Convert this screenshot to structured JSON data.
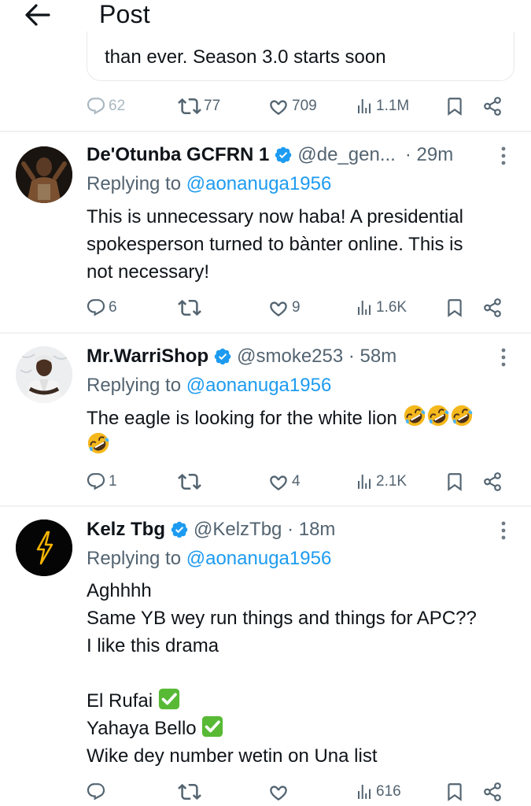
{
  "header": {
    "title": "Post"
  },
  "quote": {
    "text": "than ever. Season 3.0 starts soon"
  },
  "main_actions": {
    "replies": "62",
    "reposts": "77",
    "likes": "709",
    "views": "1.1M"
  },
  "colors": {
    "accent": "#1d9bf0",
    "secondary_text": "#536471",
    "verified": "#1d9bf0"
  },
  "replies": [
    {
      "name": "De'Otunba GCFRN 1",
      "handle": "@de_gen...",
      "time": "· 29m",
      "replying_prefix": "Replying to",
      "replying_to": "@aonanuga1956",
      "lines": [
        "This is unnecessary now haba! A presidential",
        "spokesperson turned to bànter online. This is",
        "not necessary!"
      ],
      "counts": {
        "replies": "6",
        "reposts": "",
        "likes": "9",
        "views": "1.6K"
      }
    },
    {
      "name": "Mr.WarriShop",
      "handle": "@smoke253 · 58m",
      "time": "",
      "replying_prefix": "Replying to",
      "replying_to": "@aonanuga1956",
      "lines": [
        "The eagle is looking for the white lion"
      ],
      "emoji": "rolling-on-floor-laughing",
      "counts": {
        "replies": "1",
        "reposts": "",
        "likes": "4",
        "views": "2.1K"
      }
    },
    {
      "name": "Kelz Tbg",
      "handle": "@KelzTbg · 18m",
      "time": "",
      "replying_prefix": "Replying to",
      "replying_to": "@aonanuga1956",
      "lines": [
        "Aghhhh",
        "Same YB wey run things and things for APC??",
        "I like this drama",
        "",
        "El Rufai",
        "Yahaya Bello",
        "Wike dey number wetin on Una list"
      ],
      "counts": {
        "replies": "",
        "reposts": "",
        "likes": "",
        "views": "616"
      }
    }
  ]
}
